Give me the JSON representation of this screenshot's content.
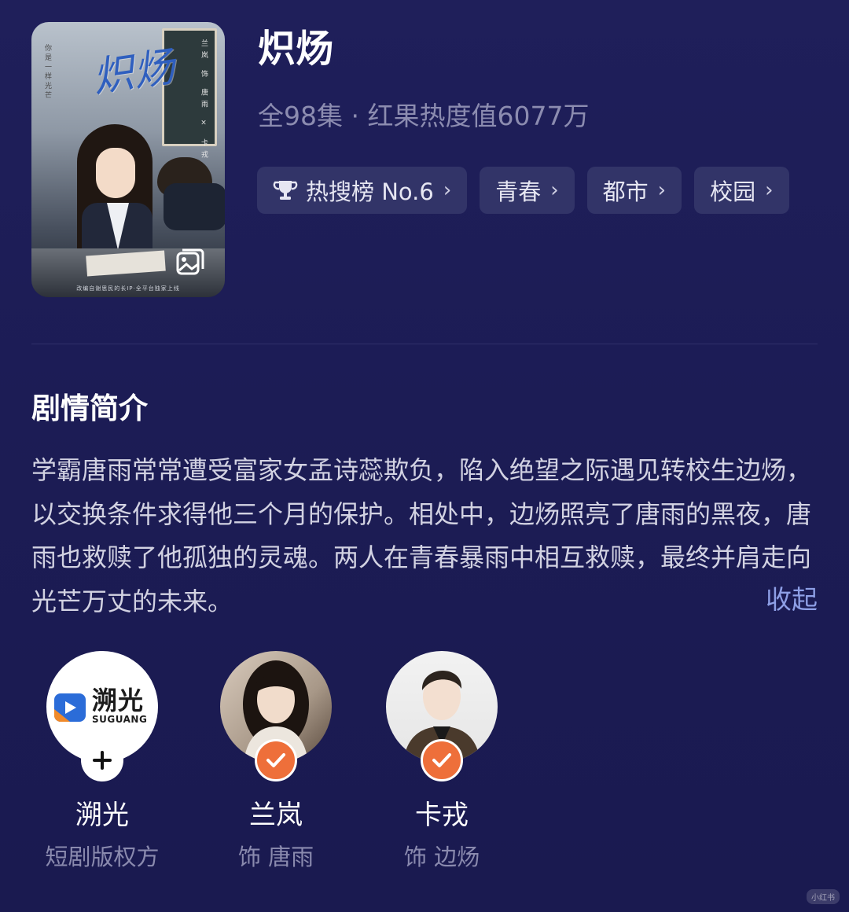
{
  "drama": {
    "title": "炽炀",
    "meta": "全98集 · 红果热度值6077万"
  },
  "poster": {
    "calligraphy": "炽炀",
    "board_text": "兰岚 饰 唐雨 × 卡戎 饰 边炀",
    "side_text": "你是一样光芒",
    "bottom_text": "改编自谢思民的长IP·全平台独家上线"
  },
  "tags": [
    {
      "label": "热搜榜 No.6",
      "icon": "trophy-icon"
    },
    {
      "label": "青春"
    },
    {
      "label": "都市"
    },
    {
      "label": "校园"
    }
  ],
  "synopsis": {
    "heading": "剧情简介",
    "text": "学霸唐雨常常遭受富家女孟诗蕊欺负，陷入绝望之际遇见转校生边炀，以交换条件求得他三个月的保护。相处中，边炀照亮了唐雨的黑夜，唐雨也救赎了他孤独的灵魂。两人在青春暴雨中相互救赎，最终并肩走向光芒万丈的未来。",
    "collapse_label": "收起"
  },
  "cast": [
    {
      "name": "溯光",
      "role": "短剧版权方",
      "logo_cn": "溯光",
      "logo_en": "SUGUANG",
      "badge": "plus-icon"
    },
    {
      "name": "兰岚",
      "role": "饰 唐雨",
      "badge": "check-icon"
    },
    {
      "name": "卡戎",
      "role": "饰 边炀",
      "badge": "check-icon"
    }
  ],
  "watermark": "小红书",
  "colors": {
    "background": "#1f1f5a",
    "tag_background": "#323468",
    "accent_link": "#8e9fe6",
    "badge_orange": "#ee6f3a",
    "meta_text": "#8c8cb0"
  }
}
